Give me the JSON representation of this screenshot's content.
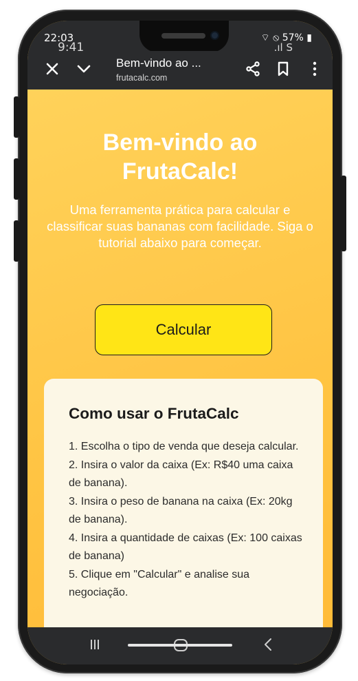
{
  "status_bar": {
    "time": "22:03",
    "time_overlay": "9:41",
    "battery": "57%",
    "right_overlay": ".ıl S"
  },
  "browser": {
    "page_title": "Bem-vindo ao ...",
    "url": "frutacalc.com",
    "icons": [
      "close-icon",
      "chevron-down-icon",
      "share-icon",
      "bookmark-icon",
      "more-vertical-icon"
    ]
  },
  "hero": {
    "title": "Bem-vindo ao FrutaCalc!",
    "subtitle": "Uma ferramenta prática para calcular e classificar suas bananas com facilidade. Siga o tutorial abaixo para começar.",
    "button_label": "Calcular"
  },
  "tutorial": {
    "title": "Como usar o FrutaCalc",
    "steps": [
      "1. Escolha o tipo de venda que deseja calcular.",
      "2. Insira o valor da caixa (Ex: R$40 uma caixa de banana).",
      "3. Insira o peso de banana na caixa (Ex: 20kg de banana).",
      "4. Insira a quantidade de caixas (Ex: 100 caixas de banana)",
      "5. Clique em \"Calcular\" e analise sua negociação."
    ]
  },
  "navbar": {
    "icons": [
      "recent-apps-icon",
      "home-icon",
      "back-icon"
    ]
  },
  "colors": {
    "page_background": "#ffc845",
    "button": "#ffe516",
    "card": "#fcf7e6",
    "browser_chrome": "#2a2b2d"
  }
}
